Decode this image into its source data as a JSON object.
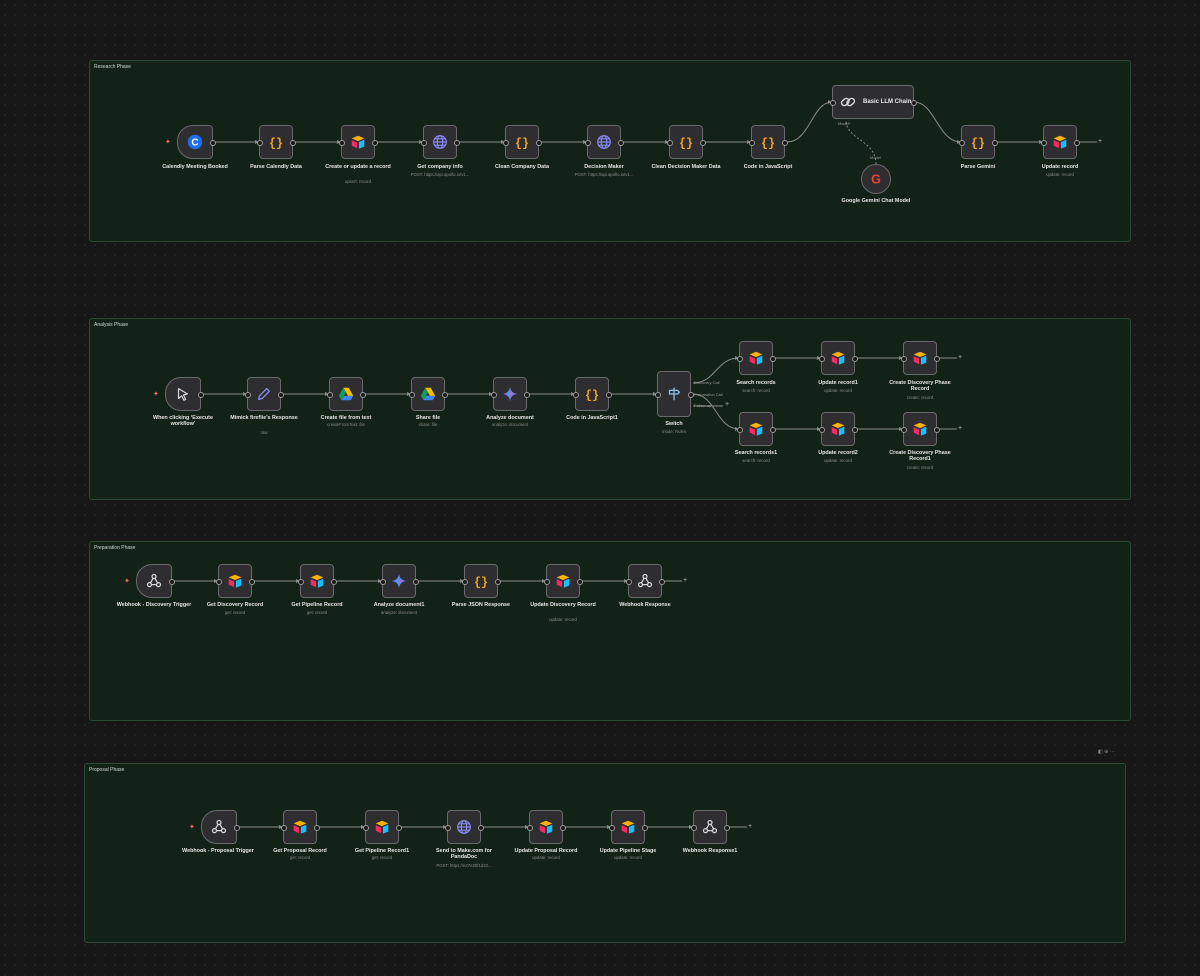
{
  "sections": {
    "research": "Research Phase",
    "analysis": "Analysis Phase",
    "preparation": "Preparation Phase",
    "proposal": "Proposal Phase"
  },
  "nodes": {
    "calendly": {
      "label": "Calendly Meeting Booked",
      "icon": "calendly-icon"
    },
    "parse_calendly": {
      "label": "Parse Calendly Data",
      "icon": "code-icon"
    },
    "create_update": {
      "label": "Create or update a record",
      "sub": "upsert: record",
      "icon": "airtable-icon"
    },
    "company_info": {
      "label": "Get company info",
      "sub": "POST: https://api.apollo.io/v1...",
      "icon": "globe-icon"
    },
    "clean_company": {
      "label": "Clean Company Data",
      "icon": "code-icon"
    },
    "decision_maker": {
      "label": "Decision Maker",
      "sub": "POST: https://api.apollo.io/v1...",
      "icon": "globe-icon"
    },
    "clean_decision": {
      "label": "Clean Decision Maker Data",
      "icon": "code-icon"
    },
    "code_js": {
      "label": "Code in JavaScript",
      "icon": "code-icon"
    },
    "llm_chain": {
      "label": "Basic LLM Chain",
      "icon": "link-icon"
    },
    "gemini_model": {
      "label": "Google Gemini Chat Model",
      "icon": "google-icon"
    },
    "parse_gemini": {
      "label": "Parse Gemini",
      "icon": "code-icon"
    },
    "update_record": {
      "label": "Update record",
      "sub": "update: record",
      "icon": "airtable-icon"
    },
    "execute": {
      "label": "When clicking ‘Execute workflow’",
      "icon": "cursor-icon"
    },
    "mimick": {
      "label": "Mimick fireflie's Response",
      "sub": "raw",
      "icon": "pencil-icon"
    },
    "create_file": {
      "label": "Create file from text",
      "sub": "createFromText: file",
      "icon": "drive-icon"
    },
    "share_file": {
      "label": "Share file",
      "sub": "share: file",
      "icon": "drive-icon"
    },
    "analyze_doc": {
      "label": "Analyze document",
      "sub": "analyze: document",
      "icon": "gemini-icon"
    },
    "code_js1": {
      "label": "Code in JavaScript1",
      "icon": "code-icon"
    },
    "switch": {
      "label": "Switch",
      "sub": "mode: Rules",
      "icon": "signpost-icon",
      "outputs": [
        "Discovery Call",
        "Preparation Call",
        "Follow-up"
      ]
    },
    "search_records": {
      "label": "Search records",
      "sub": "search: record",
      "icon": "airtable-icon"
    },
    "update_record1": {
      "label": "Update record1",
      "sub": "update: record",
      "icon": "airtable-icon"
    },
    "create_discovery": {
      "label": "Create Discovery Phase Record",
      "sub": "create: record",
      "icon": "airtable-icon"
    },
    "search_records1": {
      "label": "Search records1",
      "sub": "search: record",
      "icon": "airtable-icon"
    },
    "update_record2": {
      "label": "Update record2",
      "sub": "update: record",
      "icon": "airtable-icon"
    },
    "create_discovery1": {
      "label": "Create Discovery Phase Record1",
      "sub": "create: record",
      "icon": "airtable-icon"
    },
    "webhook_discovery": {
      "label": "Webhook - Discovery Trigger",
      "icon": "webhook-icon"
    },
    "get_discovery": {
      "label": "Get Discovery Record",
      "sub": "get: record",
      "icon": "airtable-icon"
    },
    "get_pipeline": {
      "label": "Get Pipeline Record",
      "sub": "get: record",
      "icon": "airtable-icon"
    },
    "analyze_doc1": {
      "label": "Analyze document1",
      "sub": "analyze: document",
      "icon": "gemini-icon"
    },
    "parse_json": {
      "label": "Parse JSON Response",
      "icon": "code-icon"
    },
    "update_discovery": {
      "label": "Update Discovery Record",
      "sub": "update: record",
      "icon": "airtable-icon"
    },
    "webhook_response": {
      "label": "Webhook Response",
      "icon": "webhook-icon"
    },
    "webhook_proposal": {
      "label": "Webhook - Proposal Trigger",
      "icon": "webhook-icon"
    },
    "get_proposal": {
      "label": "Get Proposal Record",
      "sub": "get: record",
      "icon": "airtable-icon"
    },
    "get_pipeline1": {
      "label": "Get Pipeline Record1",
      "sub": "get: record",
      "icon": "airtable-icon"
    },
    "send_make": {
      "label": "Send to Make.com for PandaDoc",
      "sub": "POST: https://e37e2bf1d22...",
      "icon": "globe-icon"
    },
    "update_proposal": {
      "label": "Update Proposal Record",
      "sub": "update: record",
      "icon": "airtable-icon"
    },
    "update_pipeline": {
      "label": "Update Pipeline Stage",
      "sub": "update: record",
      "icon": "airtable-icon"
    },
    "webhook_response1": {
      "label": "Webhook Response1",
      "icon": "webhook-icon"
    }
  },
  "model_port_label": "Model",
  "model_port_label_short": "Model*",
  "colors": {
    "sticky_bg": "#122217",
    "sticky_border": "#2c4a33",
    "node_bg": "#2e2e30",
    "code": "#f5a623",
    "accent": "#ff6d5a"
  }
}
